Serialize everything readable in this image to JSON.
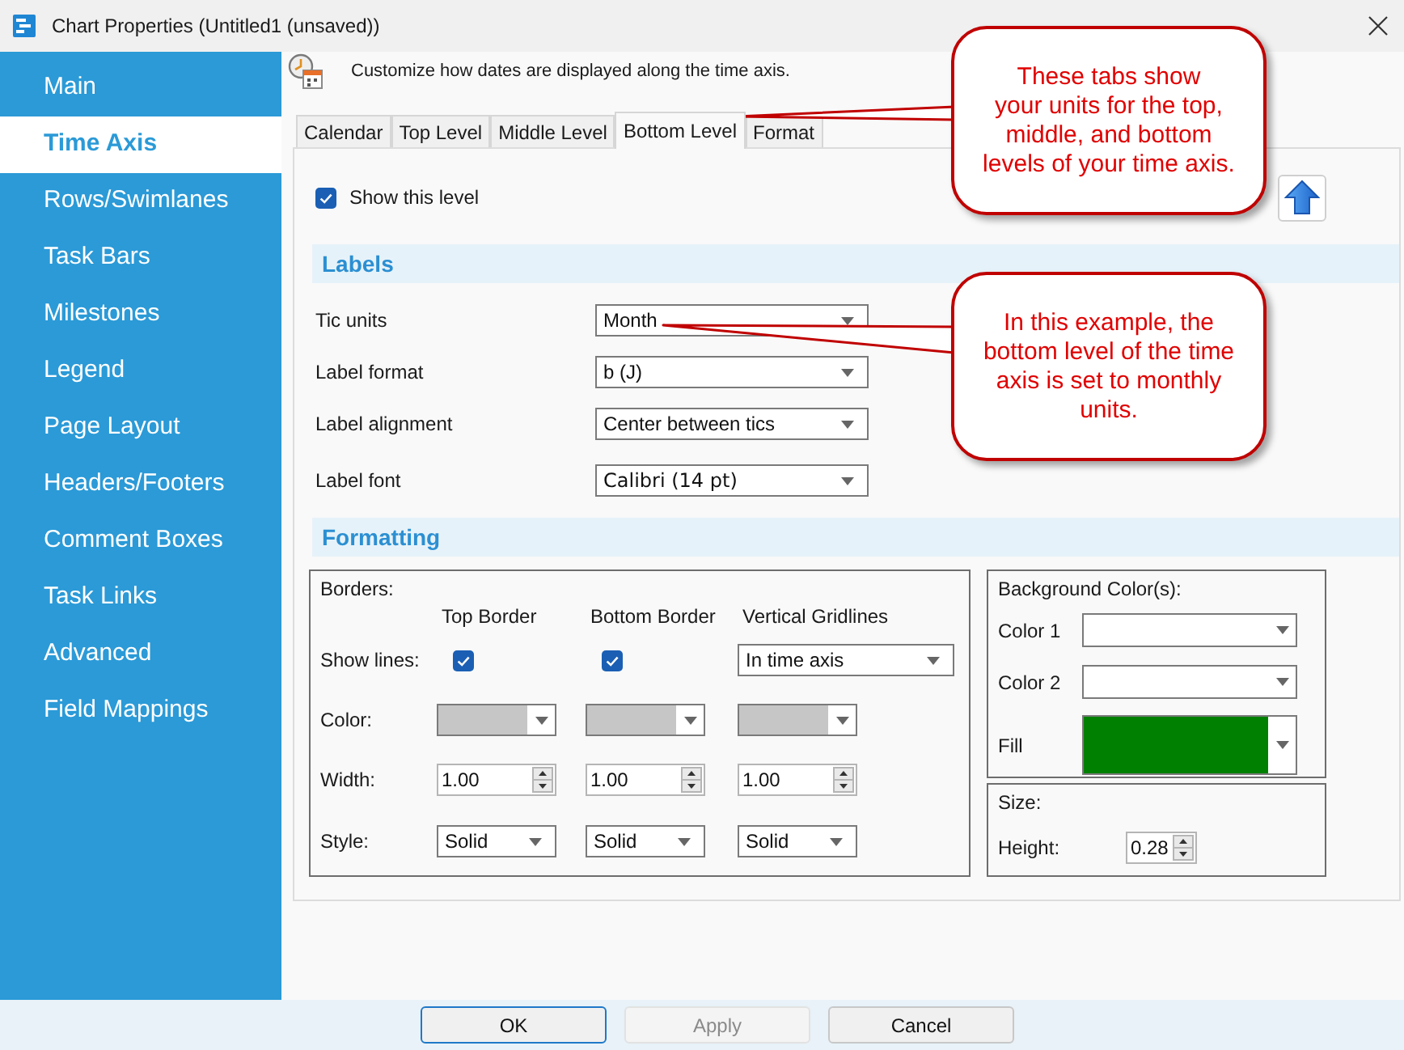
{
  "window": {
    "title": "Chart Properties (Untitled1 (unsaved))"
  },
  "sidebar": {
    "items": [
      {
        "label": "Main",
        "selected": false
      },
      {
        "label": "Time Axis",
        "selected": true
      },
      {
        "label": "Rows/Swimlanes",
        "selected": false
      },
      {
        "label": "Task Bars",
        "selected": false
      },
      {
        "label": "Milestones",
        "selected": false
      },
      {
        "label": "Legend",
        "selected": false
      },
      {
        "label": "Page Layout",
        "selected": false
      },
      {
        "label": "Headers/Footers",
        "selected": false
      },
      {
        "label": "Comment Boxes",
        "selected": false
      },
      {
        "label": "Task Links",
        "selected": false
      },
      {
        "label": "Advanced",
        "selected": false
      },
      {
        "label": "Field Mappings",
        "selected": false
      }
    ]
  },
  "header": {
    "description": "Customize how dates are displayed along the time axis."
  },
  "tabs": [
    {
      "label": "Calendar",
      "selected": false
    },
    {
      "label": "Top Level",
      "selected": false
    },
    {
      "label": "Middle Level",
      "selected": false
    },
    {
      "label": "Bottom Level",
      "selected": true
    },
    {
      "label": "Format",
      "selected": false
    }
  ],
  "show_level": {
    "label": "Show this level",
    "checked": true
  },
  "labels": {
    "title": "Labels",
    "fields": [
      {
        "kind": "select",
        "label": "Tic units",
        "value": "Month"
      },
      {
        "kind": "select",
        "label": "Label format",
        "value": "b (J)"
      },
      {
        "kind": "select",
        "label": "Label alignment",
        "value": "Center between tics"
      },
      {
        "kind": "font",
        "label": "Label font",
        "value": "Calibri (14 pt)"
      }
    ]
  },
  "formatting": {
    "title": "Formatting",
    "borders": {
      "title": "Borders:",
      "columns": [
        "Top Border",
        "Bottom Border",
        "Vertical Gridlines"
      ],
      "rows": [
        {
          "label": "Show lines:",
          "cells": [
            {
              "kind": "checkbox",
              "checked": true
            },
            {
              "kind": "checkbox",
              "checked": true
            },
            {
              "kind": "select",
              "value": "In time axis"
            }
          ]
        },
        {
          "label": "Color:",
          "cells": [
            {
              "kind": "color",
              "color": "#c6c6c6"
            },
            {
              "kind": "color",
              "color": "#c6c6c6"
            },
            {
              "kind": "color",
              "color": "#c6c6c6"
            }
          ]
        },
        {
          "label": "Width:",
          "cells": [
            {
              "kind": "spin",
              "value": "1.00"
            },
            {
              "kind": "spin",
              "value": "1.00"
            },
            {
              "kind": "spin",
              "value": "1.00"
            }
          ]
        },
        {
          "label": "Style:",
          "cells": [
            {
              "kind": "select",
              "value": "Solid"
            },
            {
              "kind": "select",
              "value": "Solid"
            },
            {
              "kind": "select",
              "value": "Solid"
            }
          ]
        }
      ]
    },
    "background": {
      "title": "Background Color(s):",
      "rows": [
        {
          "kind": "color",
          "label": "Color 1"
        },
        {
          "kind": "color",
          "label": "Color 2"
        },
        {
          "kind": "fill",
          "label": "Fill",
          "color": "#008000"
        }
      ]
    },
    "size": {
      "title": "Size:",
      "label": "Height:",
      "value": "0.28"
    }
  },
  "buttons": [
    {
      "label": "OK",
      "focused": true,
      "disabled": false
    },
    {
      "label": "Apply",
      "focused": false,
      "disabled": true
    },
    {
      "label": "Cancel",
      "focused": false,
      "disabled": false
    }
  ],
  "callouts": [
    {
      "text": "These tabs show your units for the top, middle, and bottom levels of your time axis."
    },
    {
      "text": "In this example, the bottom level of the time axis is set to monthly units."
    }
  ]
}
